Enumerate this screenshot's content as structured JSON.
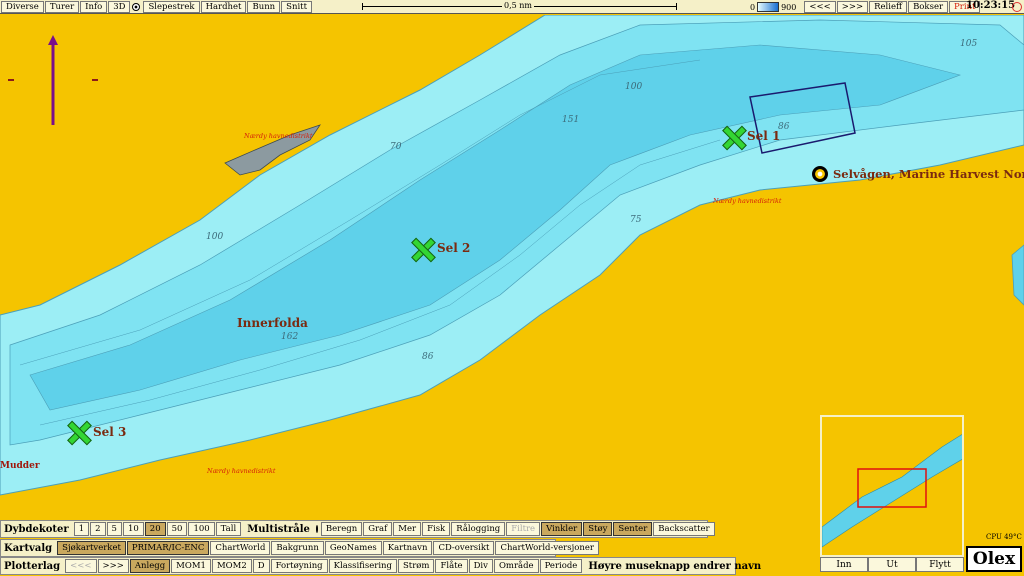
{
  "topbar": {
    "menu": [
      "Diverse",
      "Turer",
      "Info",
      "3D",
      "Slepestrek",
      "Hardhet",
      "Bunn",
      "Snitt"
    ],
    "scale_label": "0,5 nm",
    "depth_min": "0",
    "depth_max": "900",
    "nav_back": "<<<",
    "nav_forward": ">>>",
    "relieff": "Relieff",
    "bokser": "Bokser",
    "print": "Print",
    "clock": "10:23:15"
  },
  "map": {
    "place_names": {
      "innerfolda": "Innerfolda",
      "selvagen": "Selvågen, Marine Harvest Nord",
      "mudder": "Mudder"
    },
    "markers": [
      {
        "label": "Sel 1"
      },
      {
        "label": "Sel 2"
      },
      {
        "label": "Sel 3"
      }
    ],
    "depths": [
      "105",
      "100",
      "151",
      "86",
      "70",
      "75",
      "100",
      "162",
      "86"
    ],
    "warning": "Nærdy havnedistrikt"
  },
  "minimap": {
    "buttons": [
      "Inn",
      "Ut",
      "Flytt"
    ]
  },
  "cpu": "CPU 49°C",
  "logo": "Olex",
  "panels": {
    "dybdekoter": {
      "title": "Dybdekoter",
      "options": [
        "1",
        "2",
        "5",
        "10",
        "20",
        "50",
        "100",
        "Tall"
      ],
      "selected": "20"
    },
    "multistraale": {
      "title": "Multistråle",
      "buttons": [
        "Beregn",
        "Graf",
        "Mer",
        "Fisk",
        "Rålogging",
        "Filtre",
        "Vinkler",
        "Støy",
        "Senter",
        "Backscatter"
      ]
    },
    "kartvalg": {
      "title": "Kartvalg",
      "buttons": [
        "Sjøkartverket",
        "PRIMAR/IC-ENC",
        "ChartWorld",
        "Bakgrunn",
        "GeoNames",
        "Kartnavn",
        "CD-oversikt",
        "ChartWorld-versjoner"
      ]
    },
    "plotterlag": {
      "title": "Plotterlag",
      "nav_back": "<<<",
      "nav_forward": ">>>",
      "buttons": [
        "Anlegg",
        "MOM1",
        "MOM2",
        "D",
        "Fortøyning",
        "Klassifisering",
        "Strøm",
        "Flåte",
        "Div",
        "Område",
        "Periode"
      ],
      "hint": "Høyre museknapp endrer navn"
    }
  },
  "colors": {
    "land": "#f5c400",
    "water_shallow": "#9ceef5",
    "water_deep": "#5fd1ea",
    "marker": "#33d633"
  }
}
